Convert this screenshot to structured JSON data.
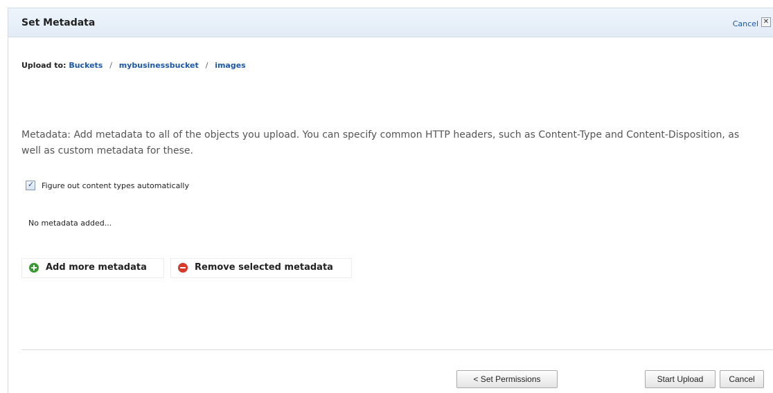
{
  "dialog": {
    "title": "Set Metadata",
    "cancel_link": "Cancel",
    "close_glyph": "✕"
  },
  "breadcrumb": {
    "prefix": "Upload to:",
    "items": [
      "Buckets",
      "mybusinessbucket",
      "images"
    ],
    "separator": "/"
  },
  "description": "Metadata: Add metadata to all of the objects you upload. You can specify common HTTP headers, such as Content-Type and Content-Disposition, as well as custom metadata for these.",
  "auto_content_types": {
    "label": "Figure out content types automatically",
    "checked": true
  },
  "empty_state": "No metadata added...",
  "actions": {
    "add_label": "Add more metadata",
    "remove_label": "Remove selected metadata"
  },
  "footer": {
    "back_label": "< Set Permissions",
    "start_label": "Start Upload",
    "cancel_label": "Cancel"
  },
  "colors": {
    "link": "#1a57a8",
    "header_bg": "#e8f0f9",
    "add_icon": "#3a9a32",
    "remove_icon": "#d8392a"
  },
  "icons": {
    "add": "plus-circle-icon",
    "remove": "minus-circle-icon",
    "close": "close-icon"
  }
}
